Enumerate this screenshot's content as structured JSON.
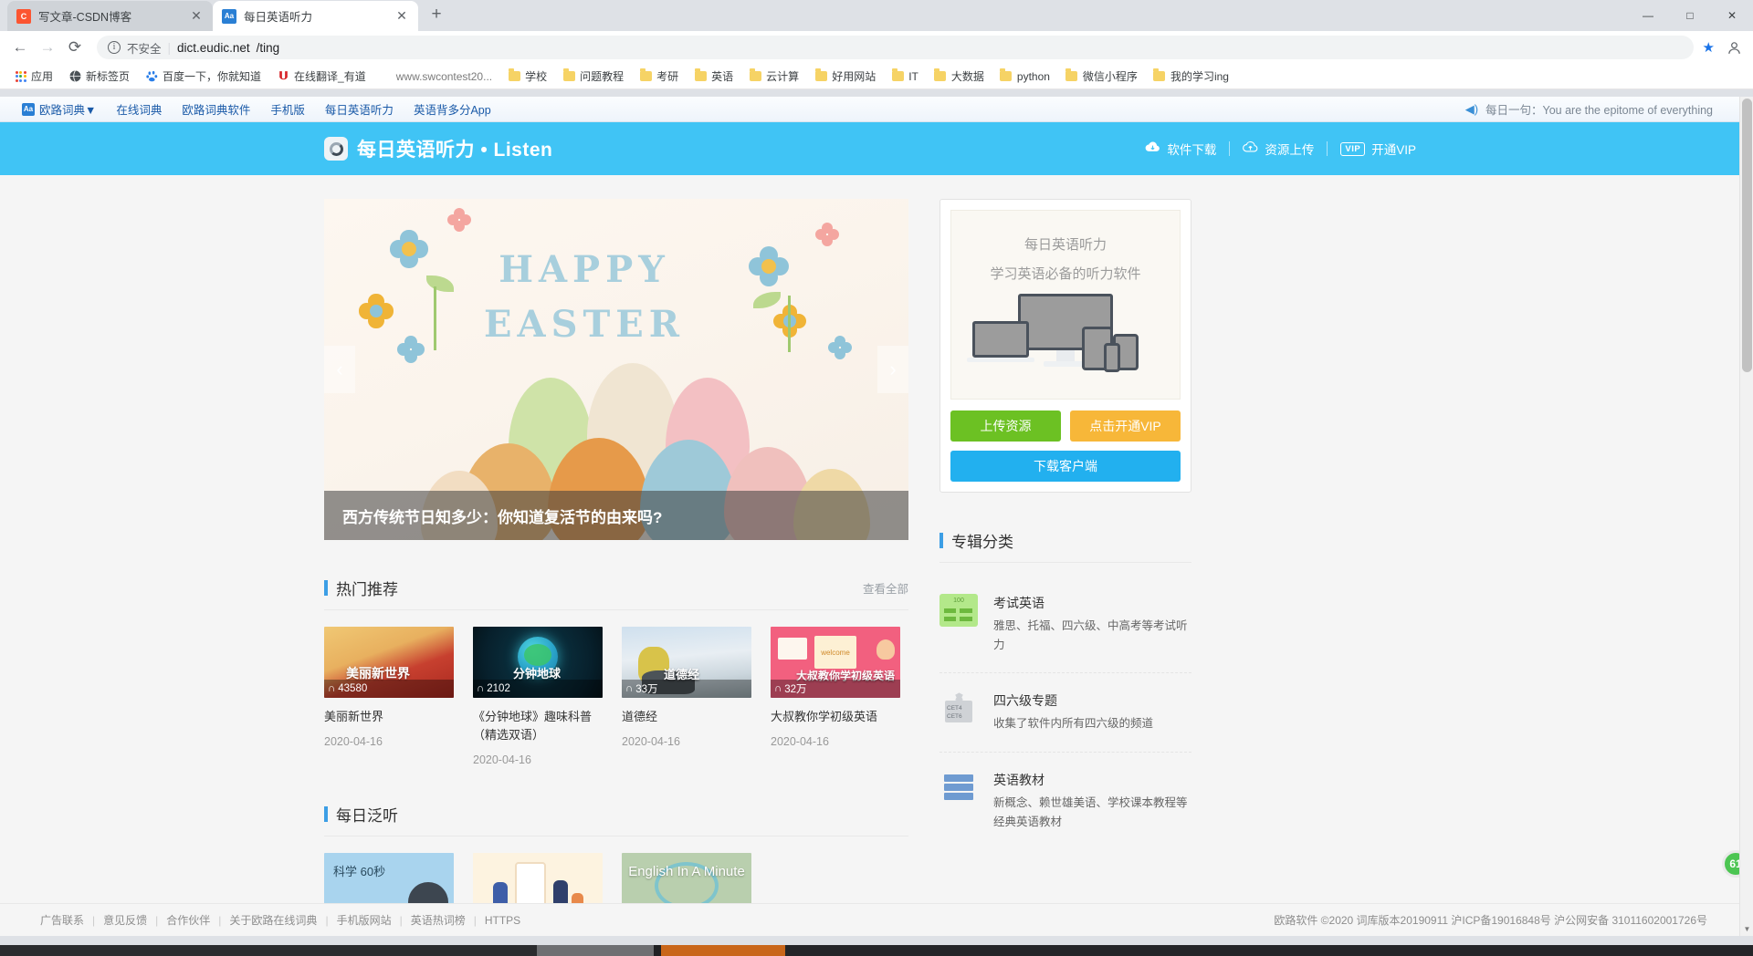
{
  "browser": {
    "tabs": [
      {
        "title": "写文章-CSDN博客",
        "favicon": "csdn-icon",
        "active": false
      },
      {
        "title": "每日英语听力",
        "favicon": "eudic-icon",
        "active": true
      }
    ],
    "new_tab_label": "+",
    "window_controls": {
      "minimize": "—",
      "maximize": "□",
      "close": "✕"
    },
    "nav": {
      "back": "←",
      "forward": "→",
      "reload": "⟳"
    },
    "omnibox": {
      "security_label": "不安全",
      "info_icon": "i",
      "url_host": "dict.eudic.net",
      "url_path": "/ting",
      "star_icon": "★",
      "profile_icon": "person-icon"
    },
    "bookmarks": [
      {
        "label": "应用",
        "icon": "apps-grid-icon"
      },
      {
        "label": "新标签页",
        "icon": "globe-icon"
      },
      {
        "label": "百度一下，你就知道",
        "icon": "baidu-icon"
      },
      {
        "label": "在线翻译_有道",
        "icon": "youdao-icon"
      },
      {
        "label": "www.swcontest20...",
        "icon": "none"
      },
      {
        "label": "学校",
        "icon": "folder-icon"
      },
      {
        "label": "问题教程",
        "icon": "folder-icon"
      },
      {
        "label": "考研",
        "icon": "folder-icon"
      },
      {
        "label": "英语",
        "icon": "folder-icon"
      },
      {
        "label": "云计算",
        "icon": "folder-icon"
      },
      {
        "label": "好用网站",
        "icon": "folder-icon"
      },
      {
        "label": "IT",
        "icon": "folder-icon"
      },
      {
        "label": "大数据",
        "icon": "folder-icon"
      },
      {
        "label": "python",
        "icon": "folder-icon"
      },
      {
        "label": "微信小程序",
        "icon": "folder-icon"
      },
      {
        "label": "我的学习ing",
        "icon": "folder-icon"
      }
    ]
  },
  "sitebar": {
    "brand": "欧路词典▼",
    "links": [
      "在线词典",
      "欧路词典软件",
      "手机版",
      "每日英语听力",
      "英语背多分App"
    ],
    "speaker_icon": "speaker-icon",
    "daily_sentence": "每日一句：You are the epitome of everything"
  },
  "header": {
    "logo_icon": "listen-logo-icon",
    "title": "每日英语听力 • Listen",
    "actions": [
      {
        "label": "软件下载",
        "icon": "cloud-download-icon"
      },
      {
        "label": "资源上传",
        "icon": "cloud-upload-icon"
      },
      {
        "label": "开通VIP",
        "icon": "vip-badge",
        "badge": "VIP"
      }
    ]
  },
  "carousel": {
    "banner_line1": "HAPPY",
    "banner_line2": "EASTER",
    "caption": "西方传统节日知多少：你知道复活节的由来吗?",
    "prev_icon": "‹",
    "next_icon": "›"
  },
  "promo": {
    "line1": "每日英语听力",
    "line2": "学习英语必备的听力软件",
    "upload_button": "上传资源",
    "vip_button": "点击开通VIP",
    "download_button": "下载客户端"
  },
  "hot": {
    "title": "热门推荐",
    "more": "查看全部",
    "cards": [
      {
        "title": "美丽新世界",
        "date": "2020-04-16",
        "plays": "43580",
        "overlay": "美丽新世界"
      },
      {
        "title": "《分钟地球》趣味科普（精选双语）",
        "date": "2020-04-16",
        "plays": "2102",
        "overlay": "分钟地球"
      },
      {
        "title": "道德经",
        "date": "2020-04-16",
        "plays": "33万",
        "overlay": "道德经"
      },
      {
        "title": "大叔教你学初级英语",
        "date": "2020-04-16",
        "plays": "32万",
        "overlay": "大叔教你学初级英语"
      }
    ]
  },
  "daily_listen": {
    "title": "每日泛听",
    "cards": [
      {
        "overlay": "科学 60秒"
      },
      {
        "overlay": ""
      },
      {
        "overlay": "English In A Minute"
      }
    ]
  },
  "categories": {
    "title": "专辑分类",
    "items": [
      {
        "name": "考试英语",
        "desc": "雅思、托福、四六级、中高考等考试听力",
        "icon": "exam-100-icon"
      },
      {
        "name": "四六级专题",
        "desc": "收集了软件内所有四六级的频道",
        "icon": "cet46-board-icon"
      },
      {
        "name": "英语教材",
        "desc": "新概念、赖世雄美语、学校课本教程等经典英语教材",
        "icon": "textbook-icon"
      }
    ]
  },
  "footer": {
    "links": [
      "广告联系",
      "意见反馈",
      "合作伙伴",
      "关于欧路在线词典",
      "手机版网站",
      "英语热词榜",
      "HTTPS"
    ],
    "copyright": "欧路软件 ©2020 词库版本20190911 沪ICP备19016848号 沪公网安备 31011602001726号"
  },
  "float_button": {
    "label": "61"
  },
  "colors": {
    "header_blue": "#40c4f5",
    "accent_blue": "#3c9ee5",
    "green": "#6cc123",
    "orange": "#f7b739",
    "download_blue": "#22b0ef"
  }
}
